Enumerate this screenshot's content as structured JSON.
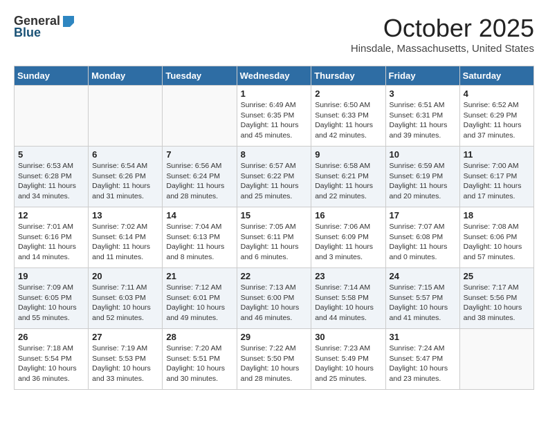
{
  "header": {
    "logo_general": "General",
    "logo_blue": "Blue",
    "month_title": "October 2025",
    "location": "Hinsdale, Massachusetts, United States"
  },
  "days_of_week": [
    "Sunday",
    "Monday",
    "Tuesday",
    "Wednesday",
    "Thursday",
    "Friday",
    "Saturday"
  ],
  "weeks": [
    [
      {
        "day": "",
        "info": ""
      },
      {
        "day": "",
        "info": ""
      },
      {
        "day": "",
        "info": ""
      },
      {
        "day": "1",
        "info": "Sunrise: 6:49 AM\nSunset: 6:35 PM\nDaylight: 11 hours\nand 45 minutes."
      },
      {
        "day": "2",
        "info": "Sunrise: 6:50 AM\nSunset: 6:33 PM\nDaylight: 11 hours\nand 42 minutes."
      },
      {
        "day": "3",
        "info": "Sunrise: 6:51 AM\nSunset: 6:31 PM\nDaylight: 11 hours\nand 39 minutes."
      },
      {
        "day": "4",
        "info": "Sunrise: 6:52 AM\nSunset: 6:29 PM\nDaylight: 11 hours\nand 37 minutes."
      }
    ],
    [
      {
        "day": "5",
        "info": "Sunrise: 6:53 AM\nSunset: 6:28 PM\nDaylight: 11 hours\nand 34 minutes."
      },
      {
        "day": "6",
        "info": "Sunrise: 6:54 AM\nSunset: 6:26 PM\nDaylight: 11 hours\nand 31 minutes."
      },
      {
        "day": "7",
        "info": "Sunrise: 6:56 AM\nSunset: 6:24 PM\nDaylight: 11 hours\nand 28 minutes."
      },
      {
        "day": "8",
        "info": "Sunrise: 6:57 AM\nSunset: 6:22 PM\nDaylight: 11 hours\nand 25 minutes."
      },
      {
        "day": "9",
        "info": "Sunrise: 6:58 AM\nSunset: 6:21 PM\nDaylight: 11 hours\nand 22 minutes."
      },
      {
        "day": "10",
        "info": "Sunrise: 6:59 AM\nSunset: 6:19 PM\nDaylight: 11 hours\nand 20 minutes."
      },
      {
        "day": "11",
        "info": "Sunrise: 7:00 AM\nSunset: 6:17 PM\nDaylight: 11 hours\nand 17 minutes."
      }
    ],
    [
      {
        "day": "12",
        "info": "Sunrise: 7:01 AM\nSunset: 6:16 PM\nDaylight: 11 hours\nand 14 minutes."
      },
      {
        "day": "13",
        "info": "Sunrise: 7:02 AM\nSunset: 6:14 PM\nDaylight: 11 hours\nand 11 minutes."
      },
      {
        "day": "14",
        "info": "Sunrise: 7:04 AM\nSunset: 6:13 PM\nDaylight: 11 hours\nand 8 minutes."
      },
      {
        "day": "15",
        "info": "Sunrise: 7:05 AM\nSunset: 6:11 PM\nDaylight: 11 hours\nand 6 minutes."
      },
      {
        "day": "16",
        "info": "Sunrise: 7:06 AM\nSunset: 6:09 PM\nDaylight: 11 hours\nand 3 minutes."
      },
      {
        "day": "17",
        "info": "Sunrise: 7:07 AM\nSunset: 6:08 PM\nDaylight: 11 hours\nand 0 minutes."
      },
      {
        "day": "18",
        "info": "Sunrise: 7:08 AM\nSunset: 6:06 PM\nDaylight: 10 hours\nand 57 minutes."
      }
    ],
    [
      {
        "day": "19",
        "info": "Sunrise: 7:09 AM\nSunset: 6:05 PM\nDaylight: 10 hours\nand 55 minutes."
      },
      {
        "day": "20",
        "info": "Sunrise: 7:11 AM\nSunset: 6:03 PM\nDaylight: 10 hours\nand 52 minutes."
      },
      {
        "day": "21",
        "info": "Sunrise: 7:12 AM\nSunset: 6:01 PM\nDaylight: 10 hours\nand 49 minutes."
      },
      {
        "day": "22",
        "info": "Sunrise: 7:13 AM\nSunset: 6:00 PM\nDaylight: 10 hours\nand 46 minutes."
      },
      {
        "day": "23",
        "info": "Sunrise: 7:14 AM\nSunset: 5:58 PM\nDaylight: 10 hours\nand 44 minutes."
      },
      {
        "day": "24",
        "info": "Sunrise: 7:15 AM\nSunset: 5:57 PM\nDaylight: 10 hours\nand 41 minutes."
      },
      {
        "day": "25",
        "info": "Sunrise: 7:17 AM\nSunset: 5:56 PM\nDaylight: 10 hours\nand 38 minutes."
      }
    ],
    [
      {
        "day": "26",
        "info": "Sunrise: 7:18 AM\nSunset: 5:54 PM\nDaylight: 10 hours\nand 36 minutes."
      },
      {
        "day": "27",
        "info": "Sunrise: 7:19 AM\nSunset: 5:53 PM\nDaylight: 10 hours\nand 33 minutes."
      },
      {
        "day": "28",
        "info": "Sunrise: 7:20 AM\nSunset: 5:51 PM\nDaylight: 10 hours\nand 30 minutes."
      },
      {
        "day": "29",
        "info": "Sunrise: 7:22 AM\nSunset: 5:50 PM\nDaylight: 10 hours\nand 28 minutes."
      },
      {
        "day": "30",
        "info": "Sunrise: 7:23 AM\nSunset: 5:49 PM\nDaylight: 10 hours\nand 25 minutes."
      },
      {
        "day": "31",
        "info": "Sunrise: 7:24 AM\nSunset: 5:47 PM\nDaylight: 10 hours\nand 23 minutes."
      },
      {
        "day": "",
        "info": ""
      }
    ]
  ]
}
